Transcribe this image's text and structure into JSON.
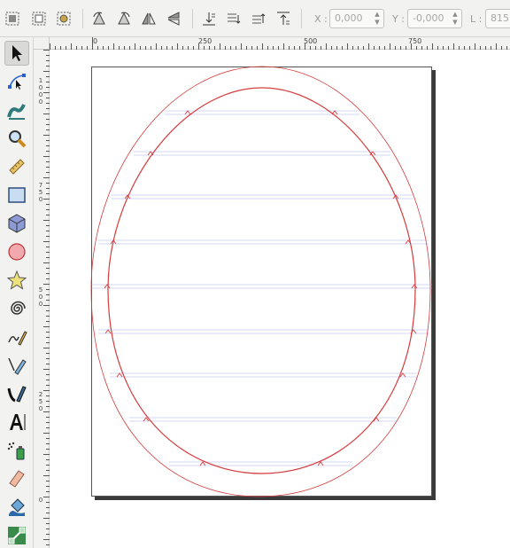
{
  "toolbar": {
    "x_label": "X :",
    "x_value": "0,000",
    "y_label": "Y :",
    "y_value": "-0,000",
    "l_label": "L :",
    "l_value": "815,"
  },
  "rulers": {
    "horizontal": [
      "0",
      "250",
      "500",
      "750"
    ],
    "vertical": [
      [
        "1",
        "0",
        "0",
        "0"
      ],
      [
        "7",
        "5",
        "0"
      ],
      [
        "5",
        "0",
        "0"
      ],
      [
        "2",
        "5",
        "0"
      ],
      [
        "0"
      ]
    ]
  },
  "toolbox": {
    "active_tool": "selector",
    "tools": [
      "selector-icon",
      "node-tool-icon",
      "tweak-tool-icon",
      "zoom-icon",
      "measure-icon",
      "rectangle-icon",
      "3d-box-icon",
      "circle-icon",
      "star-icon",
      "spiral-icon",
      "pencil-icon",
      "pen-icon",
      "calligraphy-icon",
      "text-icon",
      "spray-icon",
      "eraser-icon",
      "paint-bucket-icon",
      "connector-icon"
    ]
  },
  "colors": {
    "outline": "#d43c3c",
    "guides": "#aab0e8"
  }
}
